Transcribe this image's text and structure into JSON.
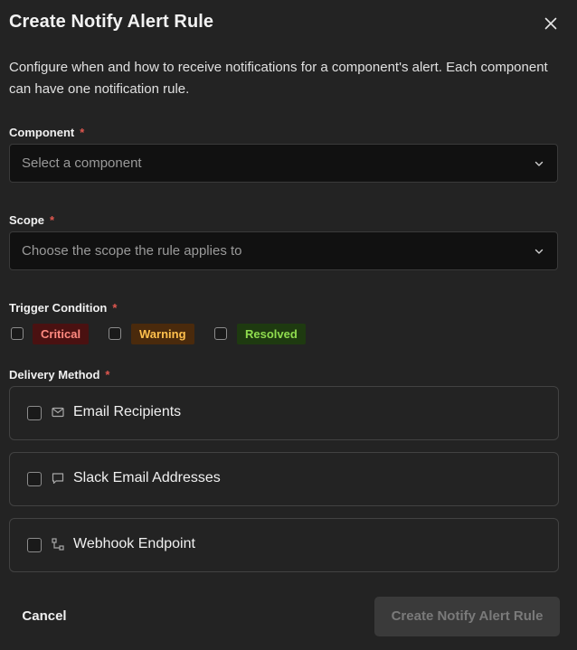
{
  "dialog": {
    "title": "Create Notify Alert Rule",
    "description": "Configure when and how to receive notifications for a component's alert. Each component can have one notification rule.",
    "close_icon": "close-icon"
  },
  "component": {
    "label": "Component",
    "required_mark": "*",
    "placeholder": "Select a component",
    "icon": "chevron-down-icon"
  },
  "scope": {
    "label": "Scope",
    "required_mark": "*",
    "placeholder": "Choose the scope the rule applies to",
    "icon": "chevron-down-icon"
  },
  "trigger": {
    "label": "Trigger Condition",
    "required_mark": "*",
    "options": [
      {
        "label": "Critical",
        "checked": false,
        "color": "#ff8a80",
        "bg": "#4a1111"
      },
      {
        "label": "Warning",
        "checked": false,
        "color": "#ffc04d",
        "bg": "#4a2a0c"
      },
      {
        "label": "Resolved",
        "checked": false,
        "color": "#8fdc4e",
        "bg": "#1e3a10"
      }
    ]
  },
  "delivery": {
    "label": "Delivery Method",
    "required_mark": "*",
    "options": [
      {
        "label": "Email Recipients",
        "icon": "mail-icon",
        "checked": false
      },
      {
        "label": "Slack Email Addresses",
        "icon": "chat-bubble-icon",
        "checked": false
      },
      {
        "label": "Webhook Endpoint",
        "icon": "webhook-icon",
        "checked": false
      }
    ]
  },
  "footer": {
    "cancel_label": "Cancel",
    "submit_label": "Create Notify Alert Rule",
    "submit_disabled": true
  },
  "colors": {
    "background": "#232323",
    "required": "#e0574f",
    "input_bg": "#111111",
    "disabled_button_bg": "#3a3a3a"
  }
}
